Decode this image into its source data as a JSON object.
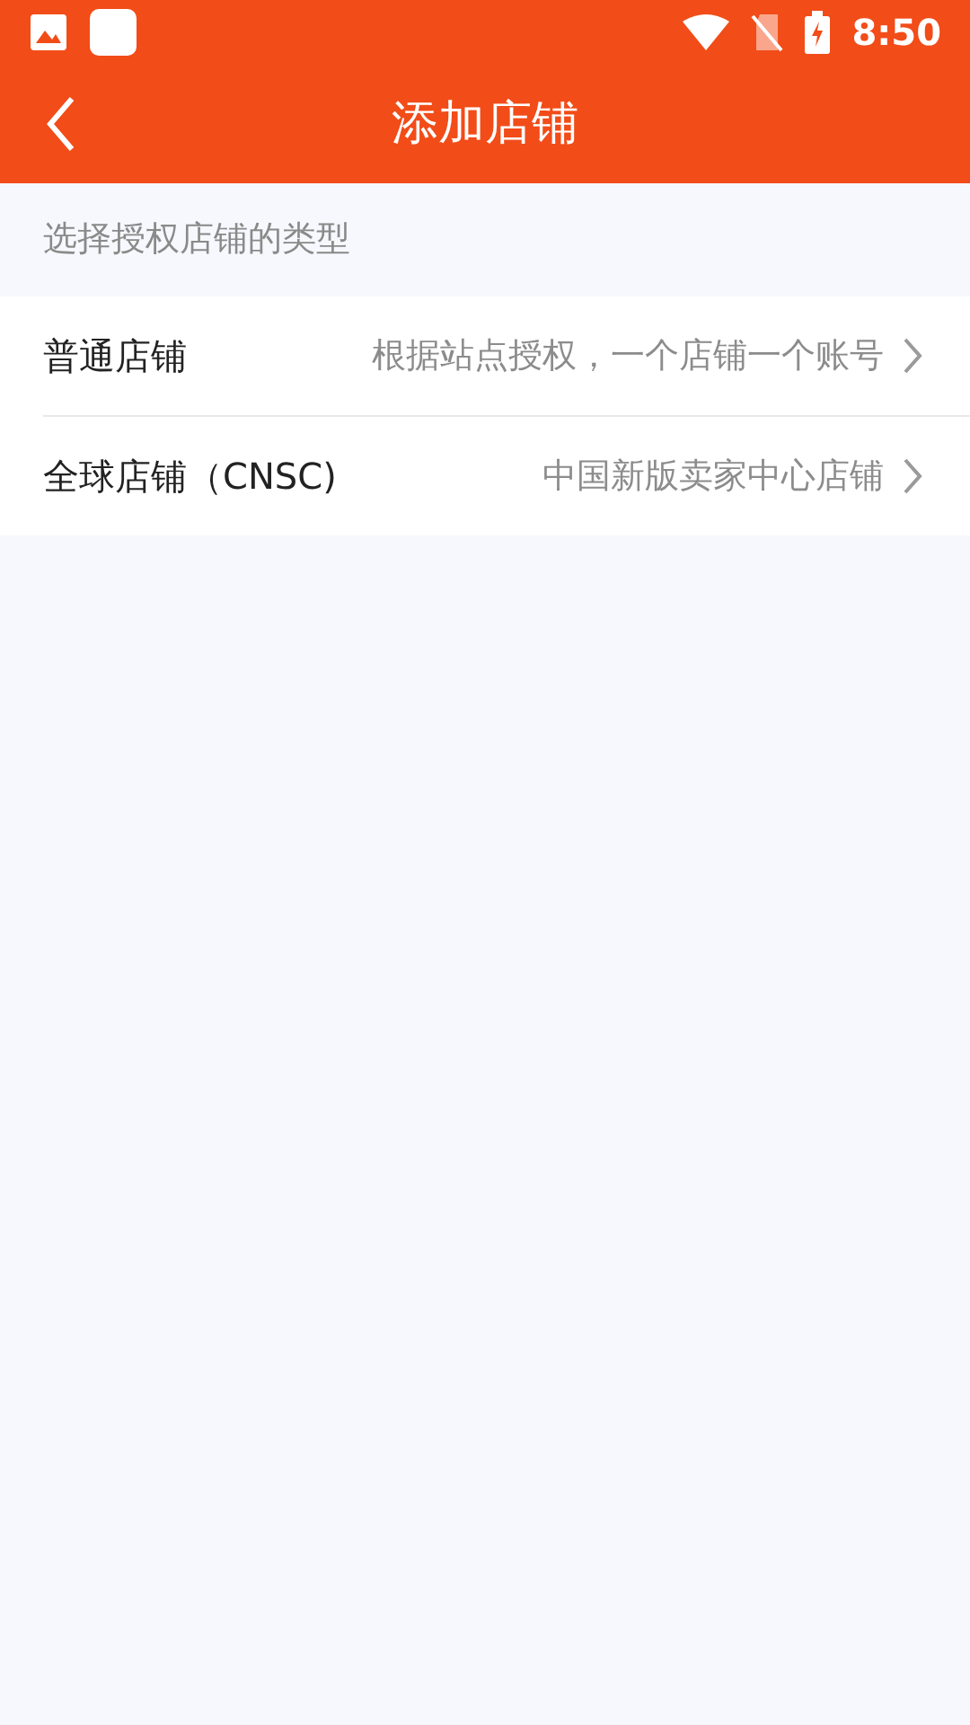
{
  "status_bar": {
    "time": "8:50"
  },
  "header": {
    "title": "添加店铺"
  },
  "section_label": "选择授权店铺的类型",
  "options": [
    {
      "title": "普通店铺",
      "description": "根据站点授权，一个店铺一个账号"
    },
    {
      "title": "全球店铺（CNSC)",
      "description": "中国新版卖家中心店铺"
    }
  ]
}
